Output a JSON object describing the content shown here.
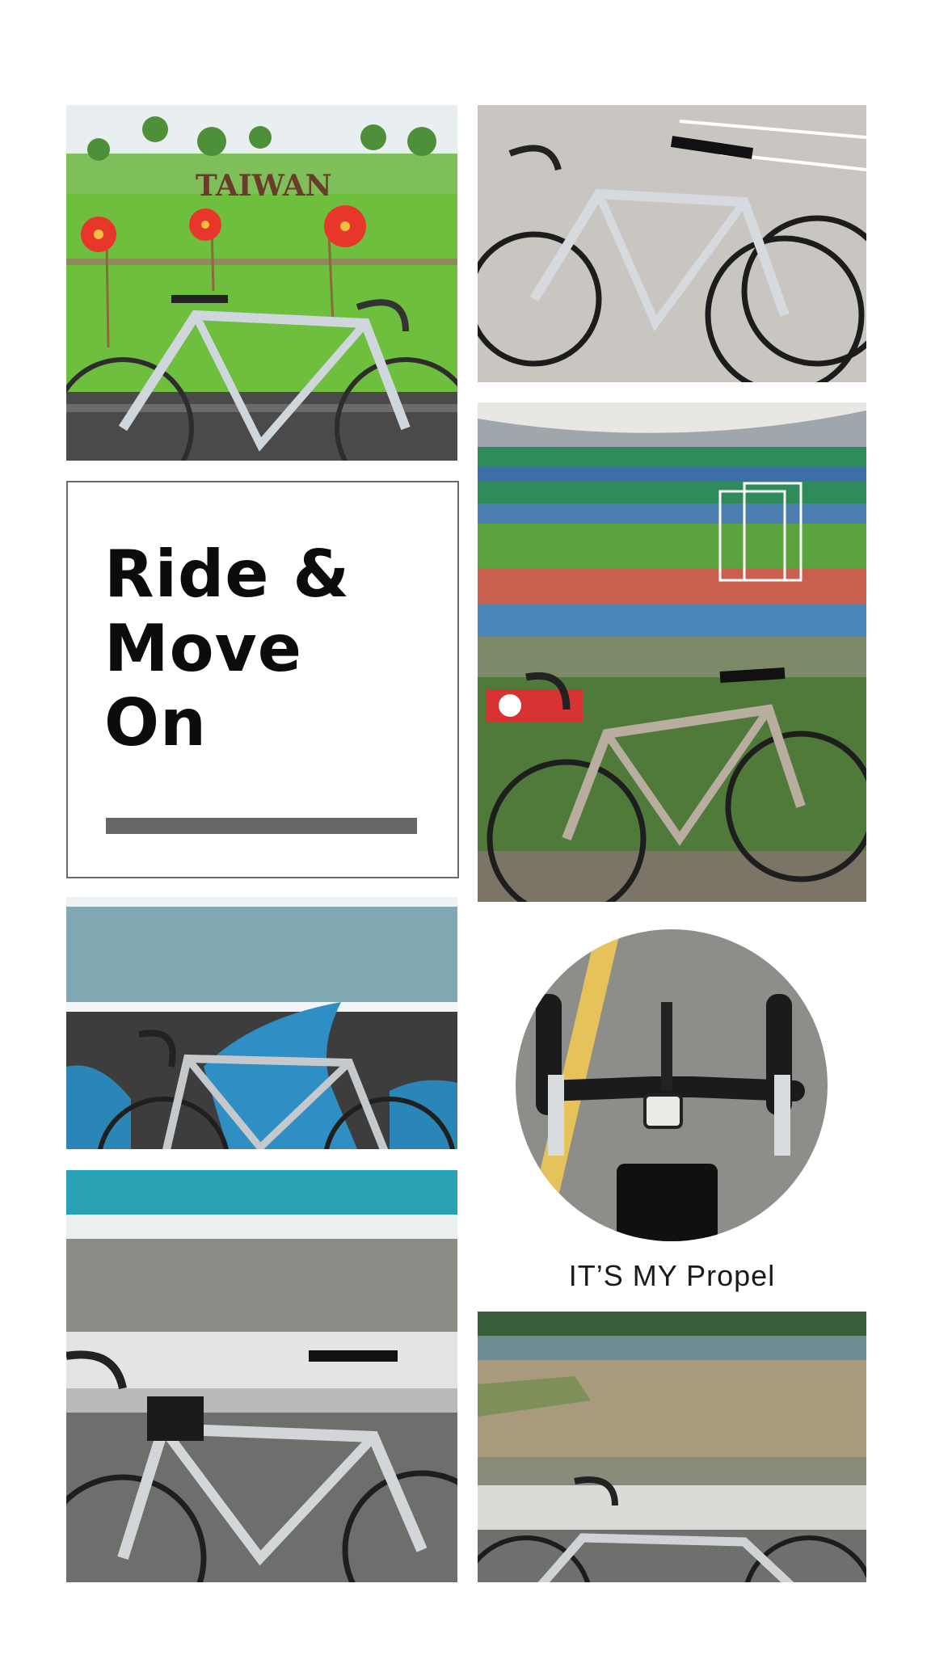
{
  "title_card": {
    "lines": [
      "Ride &",
      "Move",
      "On"
    ]
  },
  "caption": "IT’S MY Propel",
  "sign_text": "TAIWAN",
  "colors": {
    "background": "#ffffff",
    "title_text": "#0c0c0c",
    "title_bar": "#666666",
    "card_border": "#6a6a6a"
  },
  "icons": [
    "bicycle",
    "flower",
    "stadium",
    "bike-computer"
  ]
}
